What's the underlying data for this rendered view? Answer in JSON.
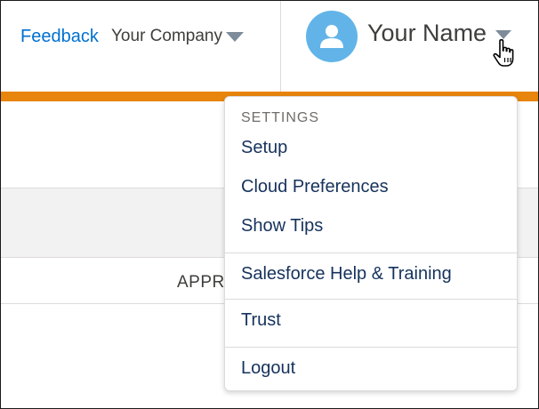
{
  "header": {
    "feedback_label": "Feedback",
    "company_name": "Your Company",
    "user_name": "Your Name"
  },
  "background": {
    "column_header_partial": "APPR"
  },
  "user_menu": {
    "section_label": "SETTINGS",
    "items": [
      {
        "label": "Setup"
      },
      {
        "label": "Cloud Preferences"
      },
      {
        "label": "Show Tips"
      },
      {
        "label": "Salesforce Help & Training"
      },
      {
        "label": "Trust"
      },
      {
        "label": "Logout"
      }
    ]
  },
  "colors": {
    "link": "#0070d2",
    "brand_strip": "#e8850c",
    "avatar": "#62b4e8",
    "menu_text": "#16325c"
  },
  "icons": {
    "avatar": "user-silhouette-icon",
    "cursor": "hand-pointer-icon"
  }
}
